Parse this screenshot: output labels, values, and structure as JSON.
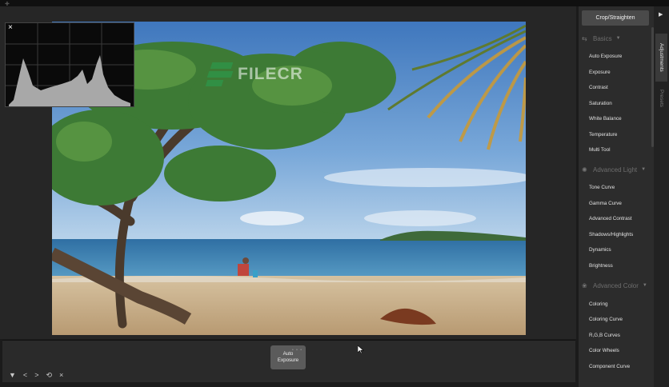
{
  "histogram": {
    "close_icon": "×"
  },
  "watermark": {
    "text": "FILECR"
  },
  "bottom_bar": {
    "preset": {
      "line1": "Auto",
      "line2": "Exposure"
    },
    "controls": [
      "▼",
      "<",
      ">",
      "⟲",
      "×"
    ]
  },
  "panel": {
    "crop_button": "Crop/Straighten",
    "sections": [
      {
        "title": "Basics",
        "icon": "sliders-icon",
        "items": [
          "Auto Exposure",
          "Exposure",
          "Contrast",
          "Saturation",
          "White Balance",
          "Temperature",
          "Multi Tool"
        ]
      },
      {
        "title": "Advanced Light",
        "icon": "sun-icon",
        "items": [
          "Tone Curve",
          "Gamma Curve",
          "Advanced Contrast",
          "Shadows/Highlights",
          "Dynamics",
          "Brightness"
        ]
      },
      {
        "title": "Advanced Color",
        "icon": "color-icon",
        "items": [
          "Coloring",
          "Coloring Curve",
          "R,G,B Curves",
          "Color Wheels",
          "Component Curve"
        ]
      }
    ]
  },
  "rail": {
    "tabs": [
      "Adjustments",
      "Presets"
    ],
    "active_tab": "Adjustments"
  },
  "colors": {
    "panel_bg": "#2c2c2c",
    "canvas_bg": "#262626",
    "sky": "#5a8fc8",
    "sea": "#3f86b8",
    "sand": "#c8ad86"
  }
}
